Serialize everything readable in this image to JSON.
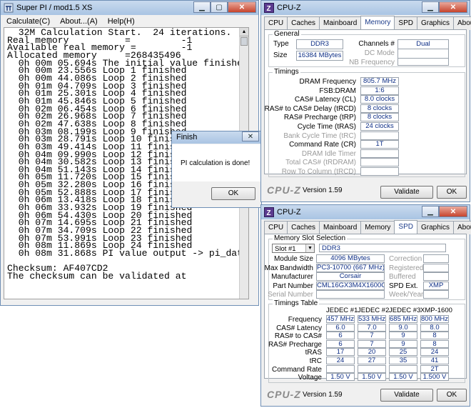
{
  "superpi": {
    "title": "Super PI / mod1.5 XS",
    "menu": [
      "Calculate(C)",
      "About...(A)",
      "Help(H)"
    ],
    "lines": [
      "  32M Calculation Start.  24 iterations.",
      "Real memory          =         -1",
      "Available real memory =        -1",
      "Allocated memory     =268435496",
      "  0h 00m 05.694s The initial value finished",
      "  0h 00m 23.556s Loop 1 finished",
      "  0h 00m 44.086s Loop 2 finished",
      "  0h 01m 04.709s Loop 3 finished",
      "  0h 01m 25.301s Loop 4 finished",
      "  0h 01m 45.846s Loop 5 finished",
      "  0h 02m 06.454s Loop 6 finished",
      "  0h 02m 26.968s Loop 7 finished",
      "  0h 02m 47.638s Loop 8 finished",
      "  0h 03m 08.199s Loop 9 finished",
      "  0h 03m 28.791s Loop 10 finished",
      "  0h 03m 49.414s Loop 11 finished",
      "  0h 04m 09.990s Loop 12 finished",
      "  0h 04m 30.582s Loop 13 finished",
      "  0h 04m 51.143s Loop 14 finished",
      "  0h 05m 11.720s Loop 15 finished",
      "  0h 05m 32.280s Loop 16 finished",
      "  0h 05m 52.888s Loop 17 finished",
      "  0h 06m 13.418s Loop 18 finished",
      "  0h 06m 33.932s Loop 19 finished",
      "  0h 06m 54.430s Loop 20 finished",
      "  0h 07m 14.695s Loop 21 finished",
      "  0h 07m 34.709s Loop 22 finished",
      "  0h 07m 53.991s Loop 23 finished",
      "  0h 08m 11.869s Loop 24 finished",
      "  0h 08m 31.868s PI value output -> pi_data.txt",
      "",
      "Checksum: AF407CD2",
      "The checksum can be validated at"
    ]
  },
  "finish": {
    "title": "Finish",
    "message": "PI calculation is done!",
    "ok": "OK"
  },
  "cpuz": {
    "title": "CPU-Z",
    "tabs": [
      "CPU",
      "Caches",
      "Mainboard",
      "Memory",
      "SPD",
      "Graphics",
      "About"
    ],
    "logo": "CPU-Z",
    "version": "Version 1.59",
    "validate": "Validate",
    "ok": "OK"
  },
  "memory": {
    "general_title": "General",
    "type_label": "Type",
    "type": "DDR3",
    "size_label": "Size",
    "size": "16384 MBytes",
    "channels_label": "Channels #",
    "channels": "Dual",
    "dc_mode_label": "DC Mode",
    "nb_freq_label": "NB Frequency",
    "timings_title": "Timings",
    "timings": [
      {
        "label": "DRAM Frequency",
        "value": "805.7 MHz",
        "gray": false
      },
      {
        "label": "FSB:DRAM",
        "value": "1:6",
        "gray": false
      },
      {
        "label": "CAS# Latency (CL)",
        "value": "8.0 clocks",
        "gray": false
      },
      {
        "label": "RAS# to CAS# Delay (tRCD)",
        "value": "8 clocks",
        "gray": false
      },
      {
        "label": "RAS# Precharge (tRP)",
        "value": "8 clocks",
        "gray": false
      },
      {
        "label": "Cycle Time (tRAS)",
        "value": "24 clocks",
        "gray": false
      },
      {
        "label": "Bank Cycle Time (tRC)",
        "value": "",
        "gray": true
      },
      {
        "label": "Command Rate (CR)",
        "value": "1T",
        "gray": false
      },
      {
        "label": "DRAM Idle Timer",
        "value": "",
        "gray": true
      },
      {
        "label": "Total CAS# (tRDRAM)",
        "value": "",
        "gray": true
      },
      {
        "label": "Row To Column (tRCD)",
        "value": "",
        "gray": true
      }
    ]
  },
  "spd": {
    "slot_title": "Memory Slot Selection",
    "slot": "Slot #1",
    "slot_type": "DDR3",
    "rows": [
      {
        "label": "Module Size",
        "value": "4096 MBytes",
        "rlabel": "Correction",
        "rvalue": ""
      },
      {
        "label": "Max Bandwidth",
        "value": "PC3-10700 (667 MHz)",
        "rlabel": "Registered",
        "rvalue": ""
      },
      {
        "label": "Manufacturer",
        "value": "Corsair",
        "rlabel": "Buffered",
        "rvalue": ""
      },
      {
        "label": "Part Number",
        "value": "CML16GX3M4X1600C8",
        "rlabel": "SPD Ext.",
        "rvalue": "XMP"
      },
      {
        "label": "Serial Number",
        "value": "",
        "rlabel": "Week/Year",
        "rvalue": ""
      }
    ],
    "timings_title": "Timings Table",
    "cols": [
      "JEDEC #1",
      "JEDEC #2",
      "JEDEC #3",
      "XMP-1600"
    ],
    "table": [
      {
        "label": "Frequency",
        "values": [
          "457 MHz",
          "533 MHz",
          "685 MHz",
          "800 MHz"
        ]
      },
      {
        "label": "CAS# Latency",
        "values": [
          "6.0",
          "7.0",
          "9.0",
          "8.0"
        ]
      },
      {
        "label": "RAS# to CAS#",
        "values": [
          "6",
          "7",
          "9",
          "8"
        ]
      },
      {
        "label": "RAS# Precharge",
        "values": [
          "6",
          "7",
          "9",
          "8"
        ]
      },
      {
        "label": "tRAS",
        "values": [
          "17",
          "20",
          "25",
          "24"
        ]
      },
      {
        "label": "tRC",
        "values": [
          "24",
          "27",
          "35",
          "41"
        ]
      },
      {
        "label": "Command Rate",
        "values": [
          "",
          "",
          "",
          "2T"
        ]
      },
      {
        "label": "Voltage",
        "values": [
          "1.50 V",
          "1.50 V",
          "1.50 V",
          "1.500 V"
        ]
      }
    ]
  }
}
